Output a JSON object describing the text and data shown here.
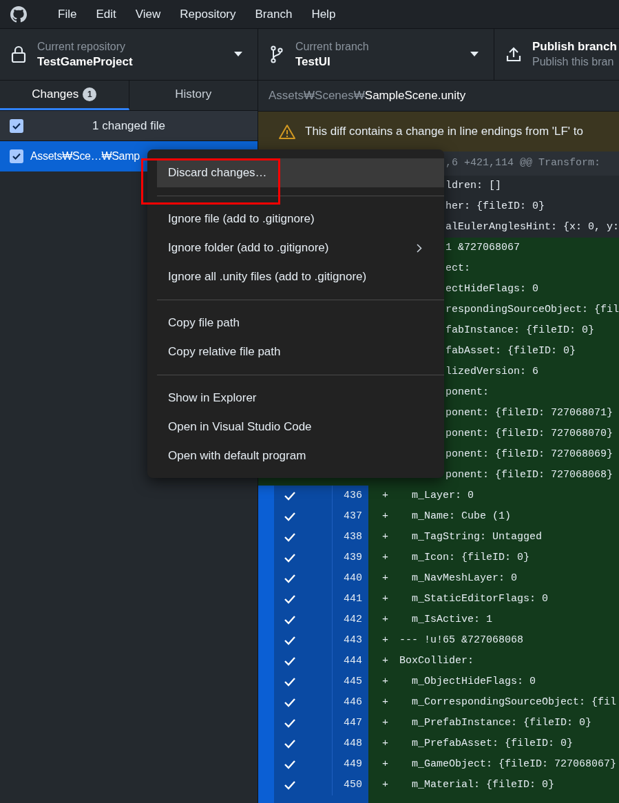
{
  "menu_bar": {
    "items": [
      "File",
      "Edit",
      "View",
      "Repository",
      "Branch",
      "Help"
    ]
  },
  "toolbar": {
    "repository": {
      "label": "Current repository",
      "value": "TestGameProject"
    },
    "branch": {
      "label": "Current branch",
      "value": "TestUI"
    },
    "publish": {
      "title": "Publish branch",
      "subtitle": "Publish this bran"
    }
  },
  "sidebar": {
    "tabs": [
      {
        "label": "Changes",
        "count": "1",
        "selected": true
      },
      {
        "label": "History",
        "selected": false
      }
    ],
    "select_all": {
      "checked": true,
      "label": "1 changed file"
    },
    "files": [
      {
        "path": "Assets₩Sce…₩Samp",
        "checked": true,
        "selected": true
      }
    ]
  },
  "diff": {
    "path_dir": "Assets₩Scenes₩",
    "path_file": "SampleScene.unity",
    "warning": "This diff contains a change in line endings from 'LF' to",
    "lines": [
      {
        "kind": "hunk",
        "covered": true,
        "text": ",6 +421,114 @@ Transform:"
      },
      {
        "kind": "context",
        "covered": true,
        "text": "ldren: []"
      },
      {
        "kind": "context",
        "covered": true,
        "text": "her: {fileID: 0}"
      },
      {
        "kind": "context",
        "covered": true,
        "text": "alEulerAnglesHint: {x: 0, y:"
      },
      {
        "kind": "added",
        "covered": true,
        "text": "1 &727068067"
      },
      {
        "kind": "added",
        "covered": true,
        "text": "ect:"
      },
      {
        "kind": "added",
        "covered": true,
        "text": "ectHideFlags: 0"
      },
      {
        "kind": "added",
        "covered": true,
        "text": "respondingSourceObject: {fil"
      },
      {
        "kind": "added",
        "covered": true,
        "text": "fabInstance: {fileID: 0}"
      },
      {
        "kind": "added",
        "covered": true,
        "text": "fabAsset: {fileID: 0}"
      },
      {
        "kind": "added",
        "covered": true,
        "text": "lizedVersion: 6"
      },
      {
        "kind": "added",
        "covered": true,
        "text": "ponent:"
      },
      {
        "kind": "added",
        "covered": true,
        "text": "ponent: {fileID: 727068071}"
      },
      {
        "kind": "added",
        "covered": true,
        "text": "ponent: {fileID: 727068070}"
      },
      {
        "kind": "added",
        "covered": true,
        "text": "ponent: {fileID: 727068069}"
      },
      {
        "kind": "added",
        "covered": true,
        "text": "ponent: {fileID: 727068068}"
      },
      {
        "kind": "added",
        "covered": false,
        "checked": true,
        "number": "436",
        "sign": "+",
        "text": "  m_Layer: 0"
      },
      {
        "kind": "added",
        "covered": false,
        "checked": true,
        "number": "437",
        "sign": "+",
        "text": "  m_Name: Cube (1)"
      },
      {
        "kind": "added",
        "covered": false,
        "checked": true,
        "number": "438",
        "sign": "+",
        "text": "  m_TagString: Untagged"
      },
      {
        "kind": "added",
        "covered": false,
        "checked": true,
        "number": "439",
        "sign": "+",
        "text": "  m_Icon: {fileID: 0}"
      },
      {
        "kind": "added",
        "covered": false,
        "checked": true,
        "number": "440",
        "sign": "+",
        "text": "  m_NavMeshLayer: 0"
      },
      {
        "kind": "added",
        "covered": false,
        "checked": true,
        "number": "441",
        "sign": "+",
        "text": "  m_StaticEditorFlags: 0"
      },
      {
        "kind": "added",
        "covered": false,
        "checked": true,
        "number": "442",
        "sign": "+",
        "text": "  m_IsActive: 1"
      },
      {
        "kind": "added",
        "covered": false,
        "checked": true,
        "number": "443",
        "sign": "+",
        "text": "--- !u!65 &727068068"
      },
      {
        "kind": "added",
        "covered": false,
        "checked": true,
        "number": "444",
        "sign": "+",
        "text": "BoxCollider:"
      },
      {
        "kind": "added",
        "covered": false,
        "checked": true,
        "number": "445",
        "sign": "+",
        "text": "  m_ObjectHideFlags: 0"
      },
      {
        "kind": "added",
        "covered": false,
        "checked": true,
        "number": "446",
        "sign": "+",
        "text": "  m_CorrespondingSourceObject: {fil"
      },
      {
        "kind": "added",
        "covered": false,
        "checked": true,
        "number": "447",
        "sign": "+",
        "text": "  m_PrefabInstance: {fileID: 0}"
      },
      {
        "kind": "added",
        "covered": false,
        "checked": true,
        "number": "448",
        "sign": "+",
        "text": "  m_PrefabAsset: {fileID: 0}"
      },
      {
        "kind": "added",
        "covered": false,
        "checked": true,
        "number": "449",
        "sign": "+",
        "text": "  m_GameObject: {fileID: 727068067}"
      },
      {
        "kind": "added",
        "covered": false,
        "checked": true,
        "number": "450",
        "sign": "+",
        "text": "  m_Material: {fileID: 0}"
      }
    ]
  },
  "context_menu": {
    "items": [
      {
        "kind": "item",
        "label": "Discard changes…",
        "hovered": true,
        "submenu": false,
        "outlined": true
      },
      {
        "kind": "separator"
      },
      {
        "kind": "item",
        "label": "Ignore file (add to .gitignore)",
        "hovered": false,
        "submenu": false
      },
      {
        "kind": "item",
        "label": "Ignore folder (add to .gitignore)",
        "hovered": false,
        "submenu": true
      },
      {
        "kind": "item",
        "label": "Ignore all .unity files (add to .gitignore)",
        "hovered": false,
        "submenu": false
      },
      {
        "kind": "separator"
      },
      {
        "kind": "item",
        "label": "Copy file path",
        "hovered": false,
        "submenu": false
      },
      {
        "kind": "item",
        "label": "Copy relative file path",
        "hovered": false,
        "submenu": false
      },
      {
        "kind": "separator"
      },
      {
        "kind": "item",
        "label": "Show in Explorer",
        "hovered": false,
        "submenu": false
      },
      {
        "kind": "item",
        "label": "Open in Visual Studio Code",
        "hovered": false,
        "submenu": false
      },
      {
        "kind": "item",
        "label": "Open with default program",
        "hovered": false,
        "submenu": false
      }
    ]
  }
}
